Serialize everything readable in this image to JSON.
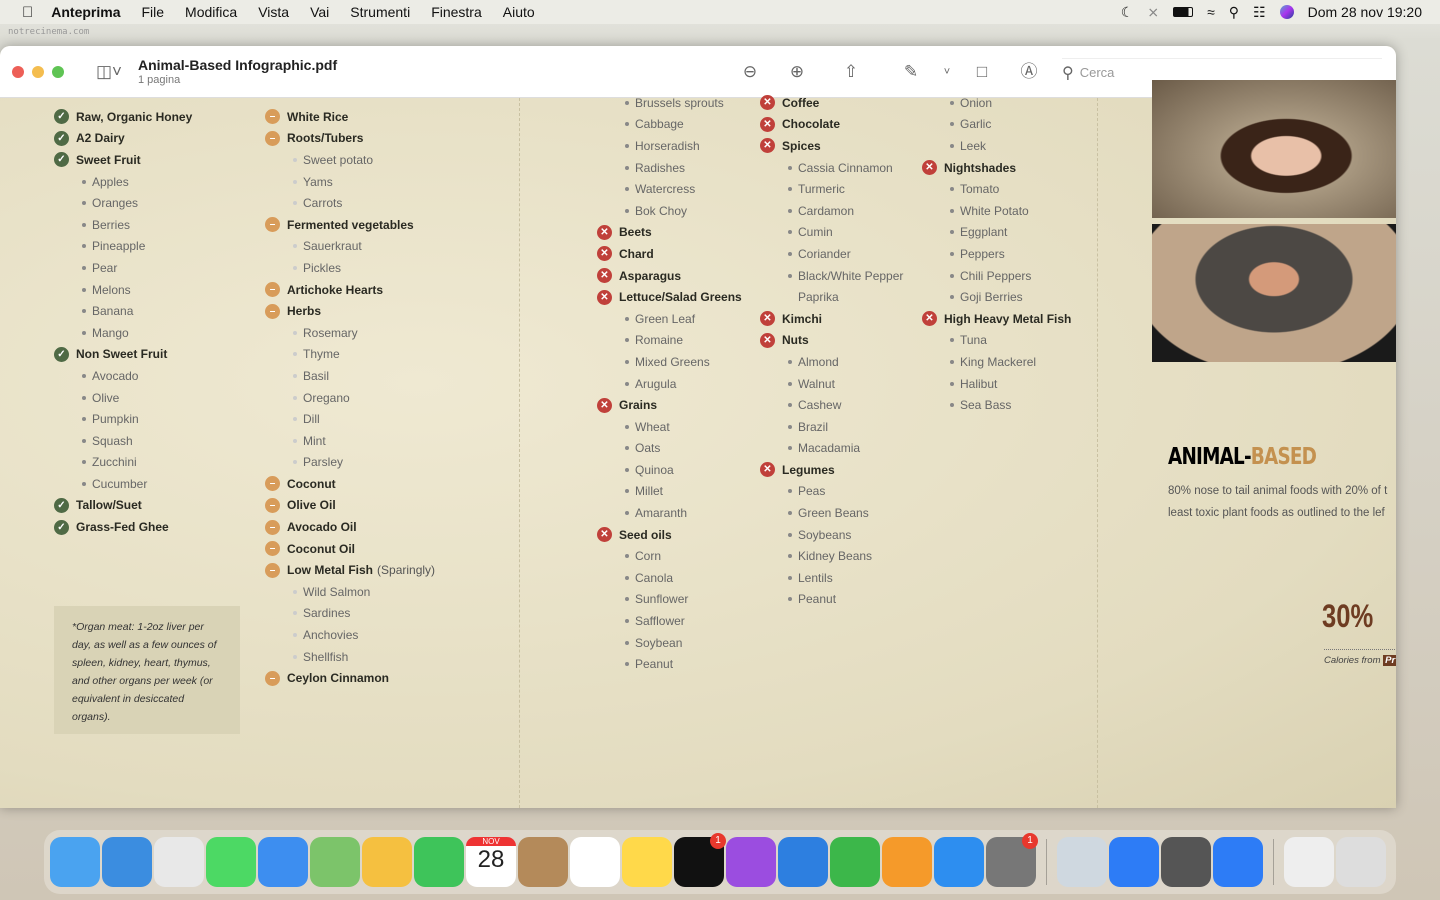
{
  "menubar": {
    "app": "Anteprima",
    "items": [
      "File",
      "Modifica",
      "Vista",
      "Vai",
      "Strumenti",
      "Finestra",
      "Aiuto"
    ],
    "datetime": "Dom 28 nov 19:20"
  },
  "watermark": "notrecinema.com",
  "window": {
    "title": "Animal-Based Infographic.pdf",
    "subtitle": "1 pagina",
    "search_placeholder": "Cerca"
  },
  "colors": {
    "good": "#4f6a45",
    "moderate": "#d89c5a",
    "bad": "#c0403a",
    "accent": "#c4914f"
  },
  "columns": [
    {
      "items": [
        [
          "good",
          "Raw, Organic Honey"
        ],
        [
          "good",
          "A2 Dairy"
        ],
        [
          "good",
          "Sweet Fruit"
        ],
        [
          "sub",
          "Apples"
        ],
        [
          "sub",
          "Oranges"
        ],
        [
          "sub",
          "Berries"
        ],
        [
          "sub",
          "Pineapple"
        ],
        [
          "sub",
          "Pear"
        ],
        [
          "sub",
          "Melons"
        ],
        [
          "sub",
          "Banana"
        ],
        [
          "sub",
          "Mango"
        ],
        [
          "good",
          "Non Sweet Fruit"
        ],
        [
          "sub",
          "Avocado"
        ],
        [
          "sub",
          "Olive"
        ],
        [
          "sub",
          "Pumpkin"
        ],
        [
          "sub",
          "Squash"
        ],
        [
          "sub",
          "Zucchini"
        ],
        [
          "sub",
          "Cucumber"
        ],
        [
          "good",
          "Tallow/Suet"
        ],
        [
          "good",
          "Grass-Fed Ghee"
        ]
      ]
    },
    {
      "items": [
        [
          "mod",
          "White Rice"
        ],
        [
          "mod",
          "Roots/Tubers"
        ],
        [
          "sub",
          "Sweet potato"
        ],
        [
          "sub",
          "Yams"
        ],
        [
          "sub",
          "Carrots"
        ],
        [
          "mod",
          "Fermented vegetables"
        ],
        [
          "sub",
          "Sauerkraut"
        ],
        [
          "sub",
          "Pickles"
        ],
        [
          "mod",
          "Artichoke Hearts"
        ],
        [
          "mod",
          "Herbs"
        ],
        [
          "sub",
          "Rosemary"
        ],
        [
          "sub",
          "Thyme"
        ],
        [
          "sub",
          "Basil"
        ],
        [
          "sub",
          "Oregano"
        ],
        [
          "sub",
          "Dill"
        ],
        [
          "sub",
          "Mint"
        ],
        [
          "sub",
          "Parsley"
        ],
        [
          "mod",
          "Coconut"
        ],
        [
          "mod",
          "Olive Oil"
        ],
        [
          "mod",
          "Avocado Oil"
        ],
        [
          "mod",
          "Coconut Oil"
        ],
        [
          "mod",
          "Low Metal Fish",
          "(Sparingly)"
        ],
        [
          "sub",
          "Wild Salmon"
        ],
        [
          "sub",
          "Sardines"
        ],
        [
          "sub",
          "Anchovies"
        ],
        [
          "sub",
          "Shellfish"
        ],
        [
          "mod",
          "Ceylon Cinnamon"
        ]
      ]
    },
    {
      "items": [
        [
          "sub",
          "Brussels sprouts"
        ],
        [
          "sub",
          "Cabbage"
        ],
        [
          "sub",
          "Horseradish"
        ],
        [
          "sub",
          "Radishes"
        ],
        [
          "sub",
          "Watercress"
        ],
        [
          "sub",
          "Bok Choy"
        ],
        [
          "bad",
          "Beets"
        ],
        [
          "bad",
          "Chard"
        ],
        [
          "bad",
          "Asparagus"
        ],
        [
          "bad",
          "Lettuce/Salad Greens"
        ],
        [
          "sub",
          "Green Leaf"
        ],
        [
          "sub",
          "Romaine"
        ],
        [
          "sub",
          "Mixed Greens"
        ],
        [
          "sub",
          "Arugula"
        ],
        [
          "bad",
          "Grains"
        ],
        [
          "sub",
          "Wheat"
        ],
        [
          "sub",
          "Oats"
        ],
        [
          "sub",
          "Quinoa"
        ],
        [
          "sub",
          "Millet"
        ],
        [
          "sub",
          "Amaranth"
        ],
        [
          "bad",
          "Seed oils"
        ],
        [
          "sub",
          "Corn"
        ],
        [
          "sub",
          "Canola"
        ],
        [
          "sub",
          "Sunflower"
        ],
        [
          "sub",
          "Safflower"
        ],
        [
          "sub",
          "Soybean"
        ],
        [
          "sub",
          "Peanut"
        ]
      ]
    },
    {
      "items": [
        [
          "bad",
          "Coffee"
        ],
        [
          "bad",
          "Chocolate"
        ],
        [
          "bad",
          "Spices"
        ],
        [
          "sub",
          "Cassia Cinnamon"
        ],
        [
          "sub",
          "Turmeric"
        ],
        [
          "sub",
          "Cardamon"
        ],
        [
          "sub",
          "Cumin"
        ],
        [
          "sub",
          "Coriander"
        ],
        [
          "sub",
          "Black/White Pepper"
        ],
        [
          "nb",
          "Paprika"
        ],
        [
          "bad",
          "Kimchi"
        ],
        [
          "bad",
          "Nuts"
        ],
        [
          "sub",
          "Almond"
        ],
        [
          "sub",
          "Walnut"
        ],
        [
          "sub",
          "Cashew"
        ],
        [
          "sub",
          "Brazil"
        ],
        [
          "sub",
          "Macadamia"
        ],
        [
          "bad",
          "Legumes"
        ],
        [
          "sub",
          "Peas"
        ],
        [
          "sub",
          "Green Beans"
        ],
        [
          "sub",
          "Soybeans"
        ],
        [
          "sub",
          "Kidney Beans"
        ],
        [
          "sub",
          "Lentils"
        ],
        [
          "sub",
          "Peanut"
        ]
      ]
    },
    {
      "items": [
        [
          "sub",
          "Onion"
        ],
        [
          "sub",
          "Garlic"
        ],
        [
          "sub",
          "Leek"
        ],
        [
          "bad",
          "Nightshades"
        ],
        [
          "sub",
          "Tomato"
        ],
        [
          "sub",
          "White Potato"
        ],
        [
          "sub",
          "Eggplant"
        ],
        [
          "sub",
          "Peppers"
        ],
        [
          "sub",
          "Chili Peppers"
        ],
        [
          "sub",
          "Goji Berries"
        ],
        [
          "bad",
          "High Heavy Metal Fish"
        ],
        [
          "sub",
          "Tuna"
        ],
        [
          "sub",
          "King Mackerel"
        ],
        [
          "sub",
          "Halibut"
        ],
        [
          "sub",
          "Sea Bass"
        ]
      ]
    }
  ],
  "note": "*Organ meat: 1-2oz liver per day, as well as a few ounces of spleen, kidney, heart, thymus, and other organs per week (or equivalent in desiccated organs).",
  "animal_based": {
    "title_a": "ANIMAL-",
    "title_b": "BASED",
    "desc_1": "80% nose to tail animal foods with 20% of t",
    "desc_2": "least toxic plant foods as outlined to the lef",
    "percent": "30%",
    "percent_label": "Calories from",
    "percent_tag": "Pr"
  },
  "dock": {
    "apps": [
      [
        "finder",
        "#4aa3f0"
      ],
      [
        "safari",
        "#3b8de0"
      ],
      [
        "launchpad",
        "#e8e8e8"
      ],
      [
        "messages",
        "#4cd964"
      ],
      [
        "mail",
        "#3d8ef0"
      ],
      [
        "maps",
        "#7cc46a"
      ],
      [
        "photos",
        "#f5c040"
      ],
      [
        "facetime",
        "#3ec45a"
      ],
      [
        "calendar",
        "#ffffff"
      ],
      [
        "contacts",
        "#b48a5a"
      ],
      [
        "reminders",
        "#ffffff"
      ],
      [
        "notes",
        "#ffd94a"
      ],
      [
        "tv",
        "#111111"
      ],
      [
        "podcasts",
        "#9b4de0"
      ],
      [
        "keynote",
        "#2d7fe0"
      ],
      [
        "numbers",
        "#3cb74a"
      ],
      [
        "pages",
        "#f59a2a"
      ],
      [
        "app-store",
        "#2d8ef0"
      ],
      [
        "system-preferences",
        "#777777"
      ],
      [
        "preview",
        "#cfd8e0"
      ],
      [
        "zoom",
        "#2d7cf6"
      ],
      [
        "keychain",
        "#555555"
      ],
      [
        "zoom-2",
        "#2d7cf6"
      ],
      [
        "documents",
        "#eeeeee"
      ],
      [
        "trash",
        "#dddddd"
      ]
    ],
    "calendar_month": "NOV",
    "calendar_day": "28",
    "tv_badge": "1",
    "settings_badge": "1"
  }
}
